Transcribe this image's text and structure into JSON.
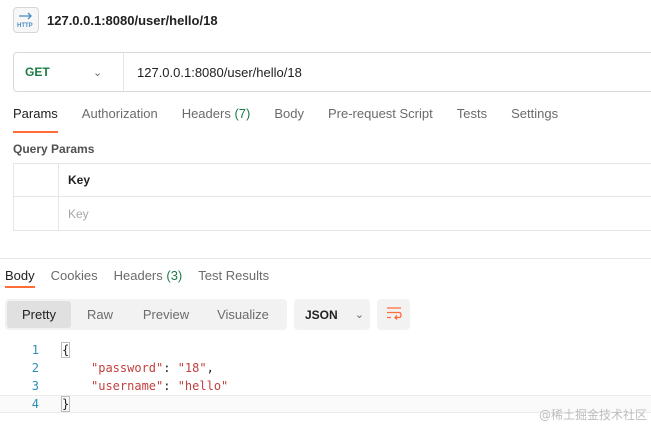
{
  "tab": {
    "title": "127.0.0.1:8080/user/hello/18",
    "icon": "http-icon"
  },
  "request": {
    "method": "GET",
    "url": "127.0.0.1:8080/user/hello/18"
  },
  "request_tabs": [
    {
      "label": "Params"
    },
    {
      "label": "Authorization"
    },
    {
      "label": "Headers",
      "count": "(7)"
    },
    {
      "label": "Body"
    },
    {
      "label": "Pre-request Script"
    },
    {
      "label": "Tests"
    },
    {
      "label": "Settings"
    }
  ],
  "query_params": {
    "title": "Query Params",
    "key_header": "Key",
    "key_placeholder": "Key"
  },
  "response_tabs": [
    {
      "label": "Body"
    },
    {
      "label": "Cookies"
    },
    {
      "label": "Headers",
      "count": "(3)"
    },
    {
      "label": "Test Results"
    }
  ],
  "view_modes": [
    "Pretty",
    "Raw",
    "Preview",
    "Visualize"
  ],
  "format": "JSON",
  "code": {
    "line_numbers": [
      "1",
      "2",
      "3",
      "4"
    ],
    "open_brace": "{",
    "close_brace": "}",
    "entries": [
      {
        "key": "\"password\"",
        "sep": ": ",
        "value": "\"18\"",
        "trail": ","
      },
      {
        "key": "\"username\"",
        "sep": ": ",
        "value": "\"hello\"",
        "trail": ""
      }
    ]
  },
  "watermark": "@稀土掘金技术社区",
  "colors": {
    "accent": "#ff6c37",
    "method": "#1c7c47",
    "json_string": "#c2403f",
    "line_number": "#2e8fb5"
  }
}
